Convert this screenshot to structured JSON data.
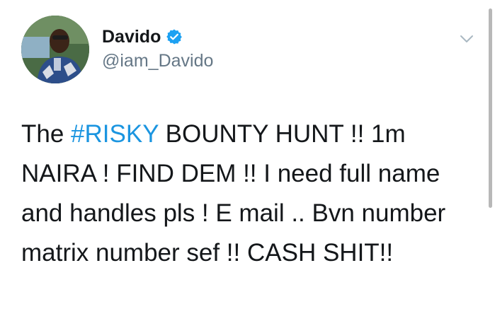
{
  "author": {
    "display_name": "Davido",
    "handle": "@iam_Davido",
    "verified": true,
    "avatar_icon": "profile-photo"
  },
  "tweet": {
    "prefix": "The ",
    "hashtag": "#RISKY",
    "body": "  BOUNTY HUNT !! 1m NAIRA ! FIND DEM !! I need full name and handles pls ! E mail .. Bvn number matrix number sef !! CASH SHIT!!"
  },
  "colors": {
    "text": "#14171a",
    "secondary": "#657786",
    "hashtag": "#1b95e0",
    "verified_badge": "#1da1f2"
  },
  "icons": {
    "verified": "verified-badge-icon",
    "menu": "chevron-down-icon"
  }
}
